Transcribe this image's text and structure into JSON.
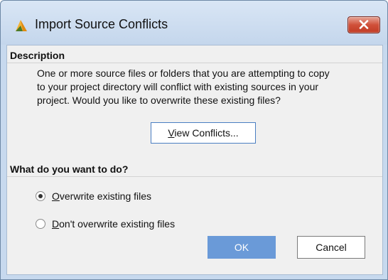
{
  "window": {
    "title": "Import Source Conflicts",
    "title_icon": "vivado-logo-icon",
    "close_icon": "close-icon"
  },
  "description": {
    "heading": "Description",
    "lines": [
      "One or more source files or folders that you are attempting to copy",
      "to your project directory will conflict with existing sources in your",
      "project. Would you like to overwrite these existing files?"
    ],
    "view_button": {
      "mnemonic": "V",
      "rest": "iew Conflicts..."
    }
  },
  "choice": {
    "heading": "What do you want to do?",
    "options": [
      {
        "mnemonic": "O",
        "rest": "verwrite existing files",
        "selected": true
      },
      {
        "mnemonic": "D",
        "rest": "on't overwrite existing files",
        "selected": false
      }
    ]
  },
  "buttons": {
    "ok": "OK",
    "cancel": "Cancel"
  },
  "colors": {
    "accent": "#6a9ad8",
    "close": "#c13b24",
    "frame": "#c7d9ee"
  }
}
